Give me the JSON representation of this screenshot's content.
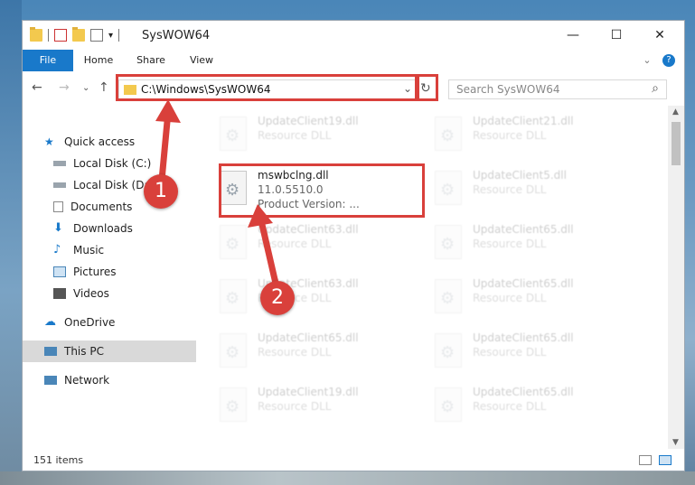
{
  "window": {
    "title": "SysWOW64",
    "min_glyph": "—",
    "max_glyph": "☐",
    "close_glyph": "✕"
  },
  "ribbon": {
    "tabs": [
      "File",
      "Home",
      "Share",
      "View"
    ],
    "chevron": "⌄",
    "help": "?"
  },
  "nav": {
    "back": "←",
    "forward": "→",
    "recent": "⌄",
    "up": "↑"
  },
  "address": {
    "path": "C:\\Windows\\SysWOW64",
    "dropdown": "⌄",
    "refresh": "↻"
  },
  "search": {
    "placeholder": "Search SysWOW64",
    "icon": "⌕"
  },
  "sidebar": {
    "items": [
      {
        "label": "Quick access",
        "icon": "star-icon"
      },
      {
        "label": "Local Disk (C:)",
        "icon": "drive-icon"
      },
      {
        "label": "Local Disk (D:)",
        "icon": "drive-icon"
      },
      {
        "label": "Documents",
        "icon": "documents-icon"
      },
      {
        "label": "Downloads",
        "icon": "download-icon"
      },
      {
        "label": "Music",
        "icon": "music-icon"
      },
      {
        "label": "Pictures",
        "icon": "pictures-icon"
      },
      {
        "label": "Videos",
        "icon": "videos-icon"
      },
      {
        "label": "OneDrive",
        "icon": "cloud-icon"
      },
      {
        "label": "This PC",
        "icon": "pc-icon"
      },
      {
        "label": "Network",
        "icon": "network-icon"
      }
    ],
    "pin_glyph": "📌"
  },
  "files": [
    {
      "name": "UpdateClient19.dll",
      "sub": "Resource DLL"
    },
    {
      "name": "UpdateClient21.dll",
      "sub": "Resource DLL"
    },
    {
      "name": "mswbclng.dll",
      "sub": "11.0.5510.0",
      "sub2": "Product Version:      ..."
    },
    {
      "name": "UpdateClient5.dll",
      "sub": "Resource DLL"
    },
    {
      "name": "UpdateClient63.dll",
      "sub": "Resource DLL"
    },
    {
      "name": "UpdateClient65.dll",
      "sub": "Resource DLL"
    },
    {
      "name": "UpdateClient63.dll",
      "sub": "Resource DLL"
    },
    {
      "name": "UpdateClient65.dll",
      "sub": "Resource DLL"
    },
    {
      "name": "UpdateClient65.dll",
      "sub": "Resource DLL"
    },
    {
      "name": "UpdateClient65.dll",
      "sub": "Resource DLL"
    },
    {
      "name": "UpdateClient19.dll",
      "sub": "Resource DLL"
    },
    {
      "name": "UpdateClient65.dll",
      "sub": "Resource DLL"
    }
  ],
  "status": {
    "count": "151 items"
  },
  "annotations": {
    "badge1": "1",
    "badge2": "2"
  },
  "colors": {
    "accent": "#1979ca",
    "highlight": "#d9403b"
  }
}
